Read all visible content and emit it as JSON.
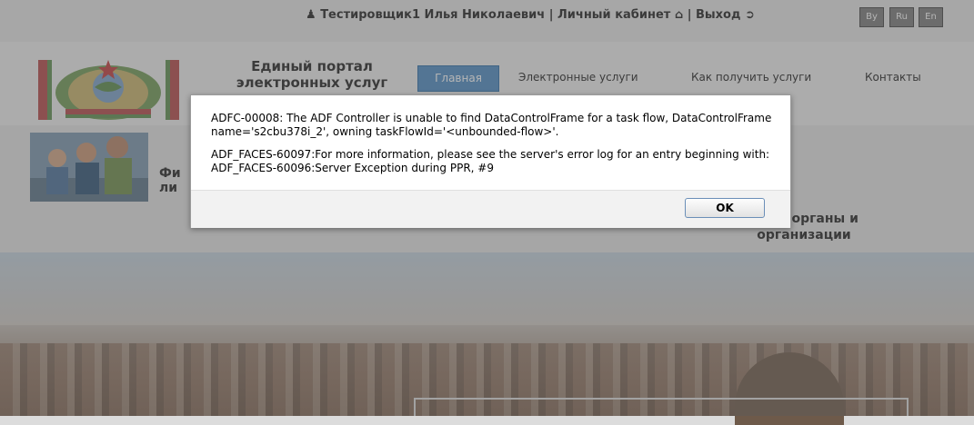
{
  "topbar": {
    "user_name": "Тестировщик1 Илья Николаевич",
    "separator": "|",
    "cabinet": "Личный кабинет",
    "cabinet_icon": "home-icon",
    "logout": "Выход",
    "logout_icon": "exit-icon",
    "languages": [
      "By",
      "Ru",
      "En"
    ],
    "user_icon": "user-icon"
  },
  "header": {
    "portal_title_line1": "Единый портал",
    "portal_title_line2": "электронных услуг",
    "nav": {
      "active": "Главная",
      "items": [
        "Электронные услуги",
        "Как получить услуги",
        "Контакты"
      ]
    },
    "accent_color": "#4d8bc4"
  },
  "content": {
    "partial_left_line1": "Фи",
    "partial_left_line2": "ли",
    "partial_right_line1": "нные органы и",
    "partial_right_line2": "организации"
  },
  "dialog": {
    "message1": "ADFC-00008: The ADF Controller is unable to find DataControlFrame for a task flow, DataControlFrame name='s2cbu378i_2', owning taskFlowId='<unbounded-flow>'.",
    "message2": "ADF_FACES-60097:For more information, please see the server's error log for an entry beginning with: ADF_FACES-60096:Server Exception during PPR, #9",
    "ok_label": "OK"
  }
}
